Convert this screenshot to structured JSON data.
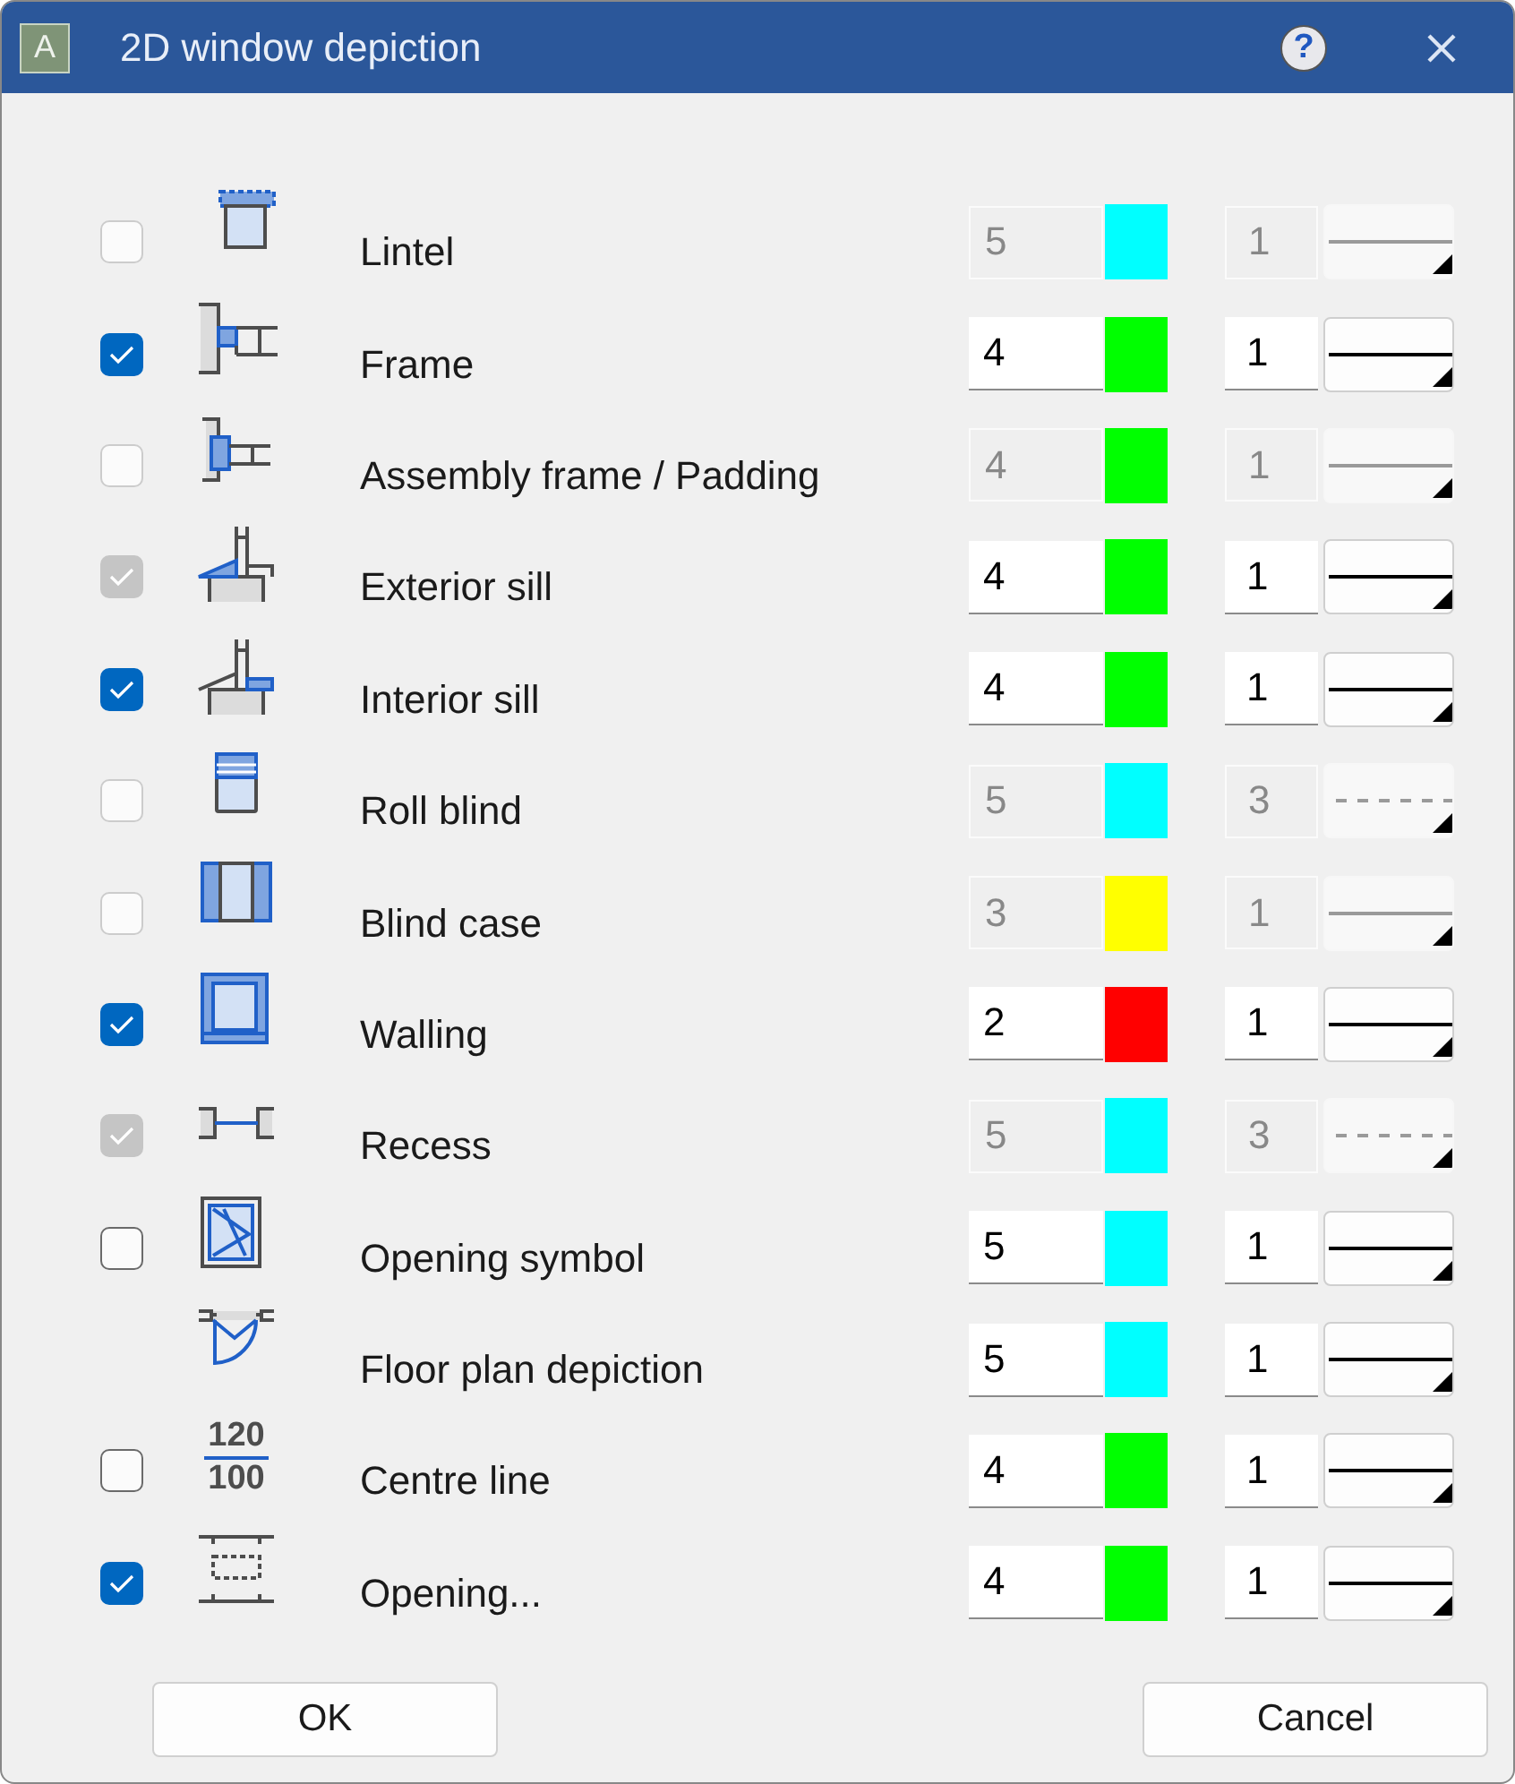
{
  "window": {
    "title": "2D window depiction",
    "app_icon": "A",
    "help": "?"
  },
  "rows": [
    {
      "label": "Lintel",
      "checkbox": {
        "checked": false,
        "disabled": true
      },
      "disabled": true,
      "pen": "5",
      "color": "#00ffff",
      "weight": "1",
      "line_style": {
        "kind": "solid"
      }
    },
    {
      "label": "Frame",
      "checkbox": {
        "checked": true,
        "disabled": false
      },
      "disabled": false,
      "pen": "4",
      "color": "#00ff00",
      "weight": "1",
      "line_style": {
        "kind": "solid"
      }
    },
    {
      "label": "Assembly frame / Padding",
      "checkbox": {
        "checked": false,
        "disabled": true
      },
      "disabled": true,
      "pen": "4",
      "color": "#00ff00",
      "weight": "1",
      "line_style": {
        "kind": "solid"
      }
    },
    {
      "label": "Exterior sill",
      "checkbox": {
        "checked": true,
        "disabled": true
      },
      "disabled": false,
      "pen": "4",
      "color": "#00ff00",
      "weight": "1",
      "line_style": {
        "kind": "solid"
      }
    },
    {
      "label": "Interior sill",
      "checkbox": {
        "checked": true,
        "disabled": false
      },
      "disabled": false,
      "pen": "4",
      "color": "#00ff00",
      "weight": "1",
      "line_style": {
        "kind": "solid"
      }
    },
    {
      "label": "Roll blind",
      "checkbox": {
        "checked": false,
        "disabled": true
      },
      "disabled": true,
      "pen": "5",
      "color": "#00ffff",
      "weight": "3",
      "line_style": {
        "kind": "dashed"
      }
    },
    {
      "label": "Blind case",
      "checkbox": {
        "checked": false,
        "disabled": true
      },
      "disabled": true,
      "pen": "3",
      "color": "#ffff00",
      "weight": "1",
      "line_style": {
        "kind": "solid"
      }
    },
    {
      "label": "Walling",
      "checkbox": {
        "checked": true,
        "disabled": false
      },
      "disabled": false,
      "pen": "2",
      "color": "#ff0000",
      "weight": "1",
      "line_style": {
        "kind": "solid"
      }
    },
    {
      "label": "Recess",
      "checkbox": {
        "checked": true,
        "disabled": true
      },
      "disabled": true,
      "pen": "5",
      "color": "#00ffff",
      "weight": "3",
      "line_style": {
        "kind": "dashed"
      }
    },
    {
      "label": "Opening symbol",
      "checkbox": {
        "checked": false,
        "disabled": false
      },
      "disabled": false,
      "pen": "5",
      "color": "#00ffff",
      "weight": "1",
      "line_style": {
        "kind": "solid"
      }
    },
    {
      "label": "Floor plan depiction",
      "disabled": false,
      "pen": "5",
      "color": "#00ffff",
      "weight": "1",
      "line_style": {
        "kind": "solid"
      }
    },
    {
      "label": "Centre line",
      "icon_text": [
        "120",
        "100"
      ],
      "checkbox": {
        "checked": false,
        "disabled": false
      },
      "disabled": false,
      "pen": "4",
      "color": "#00ff00",
      "weight": "1",
      "line_style": {
        "kind": "solid"
      }
    },
    {
      "label": "Opening...",
      "checkbox": {
        "checked": true,
        "disabled": false
      },
      "disabled": false,
      "pen": "4",
      "color": "#00ff00",
      "weight": "1",
      "line_style": {
        "kind": "solid"
      }
    }
  ],
  "buttons": [
    "OK",
    "Cancel"
  ]
}
